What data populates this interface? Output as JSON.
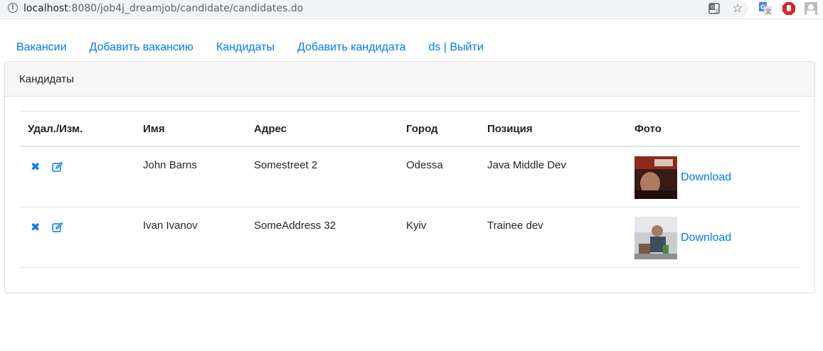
{
  "browser": {
    "url_host": "localhost",
    "url_rest": ":8080/job4j_dreamjob/candidate/candidates.do"
  },
  "nav": {
    "items": [
      {
        "label": "Вакансии"
      },
      {
        "label": "Добавить вакансию"
      },
      {
        "label": "Кандидаты"
      },
      {
        "label": "Добавить кандидата"
      },
      {
        "label": "ds | Выйти"
      }
    ]
  },
  "card": {
    "title": "Кандидаты"
  },
  "table": {
    "headers": [
      "Удал./Изм.",
      "Имя",
      "Адрес",
      "Город",
      "Позиция",
      "Фото"
    ],
    "rows": [
      {
        "name": "John Barns",
        "address": "Somestreet 2",
        "city": "Odessa",
        "position": "Java Middle Dev",
        "photo_link": "Download"
      },
      {
        "name": "Ivan Ivanov",
        "address": "SomeAddress 32",
        "city": "Kyiv",
        "position": "Trainee dev",
        "photo_link": "Download"
      }
    ],
    "delete_glyph": "✖"
  },
  "icons": {
    "delete": "close-x-icon",
    "edit": "edit-icon",
    "info": "info-icon",
    "star": "star-icon"
  },
  "colors": {
    "link": "#007bff",
    "header_bg": "#f7f7f7",
    "border": "#dee2e6"
  }
}
